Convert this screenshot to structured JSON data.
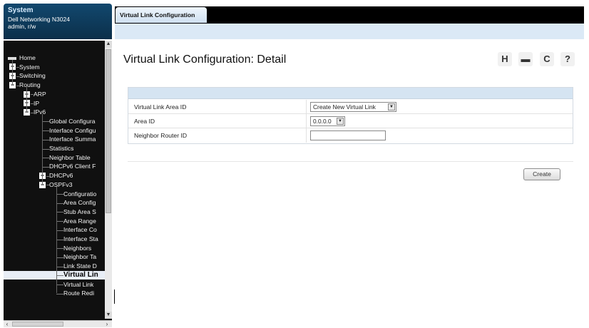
{
  "system": {
    "title": "System",
    "device": "Dell Networking N3024",
    "user": "admin, r/w"
  },
  "tree": [
    {
      "label": "Home",
      "indent": 0,
      "marker": "home"
    },
    {
      "label": "System",
      "indent": 0,
      "marker": "plus"
    },
    {
      "label": "Switching",
      "indent": 0,
      "marker": "plus"
    },
    {
      "label": "Routing",
      "indent": 0,
      "marker": "minus"
    },
    {
      "label": "ARP",
      "indent": 1,
      "marker": "plus"
    },
    {
      "label": "IP",
      "indent": 1,
      "marker": "plus"
    },
    {
      "label": "IPv6",
      "indent": 1,
      "marker": "minus"
    },
    {
      "label": "Global Configura",
      "indent": 2,
      "marker": "none"
    },
    {
      "label": "Interface Configu",
      "indent": 2,
      "marker": "none"
    },
    {
      "label": "Interface Summa",
      "indent": 2,
      "marker": "none"
    },
    {
      "label": "Statistics",
      "indent": 2,
      "marker": "none"
    },
    {
      "label": "Neighbor Table",
      "indent": 2,
      "marker": "none"
    },
    {
      "label": "DHCPv6 Client F",
      "indent": 2,
      "marker": "none"
    },
    {
      "label": "DHCPv6",
      "indent": 2,
      "marker": "plus"
    },
    {
      "label": "OSPFv3",
      "indent": 2,
      "marker": "minus"
    },
    {
      "label": "Configuratio",
      "indent": 3,
      "marker": "none"
    },
    {
      "label": "Area Config",
      "indent": 3,
      "marker": "none"
    },
    {
      "label": "Stub Area S",
      "indent": 3,
      "marker": "none"
    },
    {
      "label": "Area Range",
      "indent": 3,
      "marker": "none"
    },
    {
      "label": "Interface Co",
      "indent": 3,
      "marker": "none"
    },
    {
      "label": "Interface Sta",
      "indent": 3,
      "marker": "none"
    },
    {
      "label": "Neighbors",
      "indent": 3,
      "marker": "none"
    },
    {
      "label": "Neighbor Ta",
      "indent": 3,
      "marker": "none"
    },
    {
      "label": "Link State D",
      "indent": 3,
      "marker": "none"
    },
    {
      "label": "Virtual Lin",
      "indent": 3,
      "marker": "none",
      "selected": true
    },
    {
      "label": "Virtual Link",
      "indent": 3,
      "marker": "none"
    },
    {
      "label": "Route Redi",
      "indent": 3,
      "marker": "none"
    }
  ],
  "tab": {
    "label": "Virtual Link Configuration"
  },
  "page": {
    "title": "Virtual Link Configuration: Detail"
  },
  "toolbar": {
    "save_icon": "H",
    "print_icon": "▬",
    "refresh_icon": "C",
    "help_icon": "?"
  },
  "form": {
    "rows": [
      {
        "label": "Virtual Link Area ID",
        "control": "select",
        "value": "Create New Virtual Link"
      },
      {
        "label": "Area ID",
        "control": "select",
        "value": "0.0.0.0"
      },
      {
        "label": "Neighbor Router ID",
        "control": "text",
        "value": ""
      }
    ]
  },
  "buttons": {
    "create": "Create"
  }
}
